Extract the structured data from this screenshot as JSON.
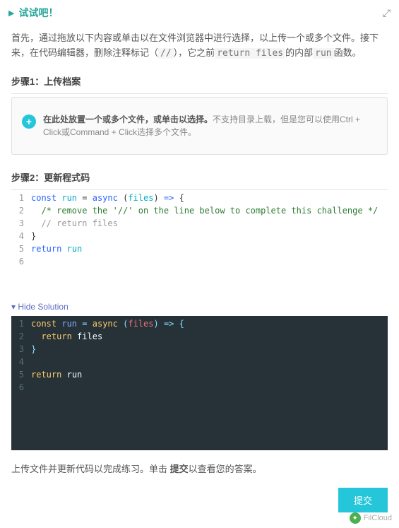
{
  "header": {
    "title": "试试吧！"
  },
  "intro": {
    "part1": "首先，通过拖放以下内容或单击以在文件浏览器中进行选择，以上传一个或多个文件。接下来，在代码编辑器，删除注释标记（",
    "code1": "//",
    "part2": "），它之前",
    "code2": "return files",
    "part3": "的内部",
    "code3": "run",
    "part4": "函数。"
  },
  "step1": {
    "title": "步骤1：上传档案",
    "upload_bold": "在此处放置一个或多个文件，或单击以选择。",
    "upload_rest": "不支持目录上载，但是您可以使用Ctrl + Click或Command + Click选择多个文件。"
  },
  "step2": {
    "title": "步骤2：更新程式码"
  },
  "code_light": {
    "lines": [
      {
        "num": "1",
        "content_html": "<span class='kw-blue'>const</span> <span class='kw-cyan'>run</span> = <span class='kw-blue'>async</span> (<span class='kw-cyan'>files</span>) <span class='kw-blue'>=&gt;</span> {"
      },
      {
        "num": "2",
        "content_html": "  <span class='kw-green'>/* remove the '//' on the line below to complete this challenge */</span>"
      },
      {
        "num": "3",
        "content_html": "  <span class='kw-gray'>// return files</span>"
      },
      {
        "num": "4",
        "content_html": "}"
      },
      {
        "num": "5",
        "content_html": "<span class='kw-blue'>return</span> <span class='kw-cyan'>run</span>"
      },
      {
        "num": "6",
        "content_html": ""
      }
    ]
  },
  "hide_solution_label": "▾ Hide Solution",
  "code_dark": {
    "lines": [
      {
        "num": "1",
        "content_html": "<span class='d-kw'>const</span> <span class='d-blue'>run</span> <span class='d-cyan'>=</span> <span class='d-kw'>async</span> <span class='d-cyan'>(</span><span class='d-red'>files</span><span class='d-cyan'>)</span> <span class='d-cyan'>=&gt;</span> <span class='d-cyan'>{</span>"
      },
      {
        "num": "2",
        "content_html": "  <span class='d-kw'>return</span> <span class='d-white'>files</span>"
      },
      {
        "num": "3",
        "content_html": "<span class='d-cyan'>}</span>"
      },
      {
        "num": "4",
        "content_html": ""
      },
      {
        "num": "5",
        "content_html": "<span class='d-kw'>return</span> <span class='d-white'>run</span>"
      },
      {
        "num": "6",
        "content_html": ""
      }
    ]
  },
  "bottom": {
    "part1": "上传文件并更新代码以完成练习。单击 ",
    "bold": "提交",
    "part2": "以查看您的答案。"
  },
  "submit_label": "提交",
  "watermark": "FilCloud"
}
